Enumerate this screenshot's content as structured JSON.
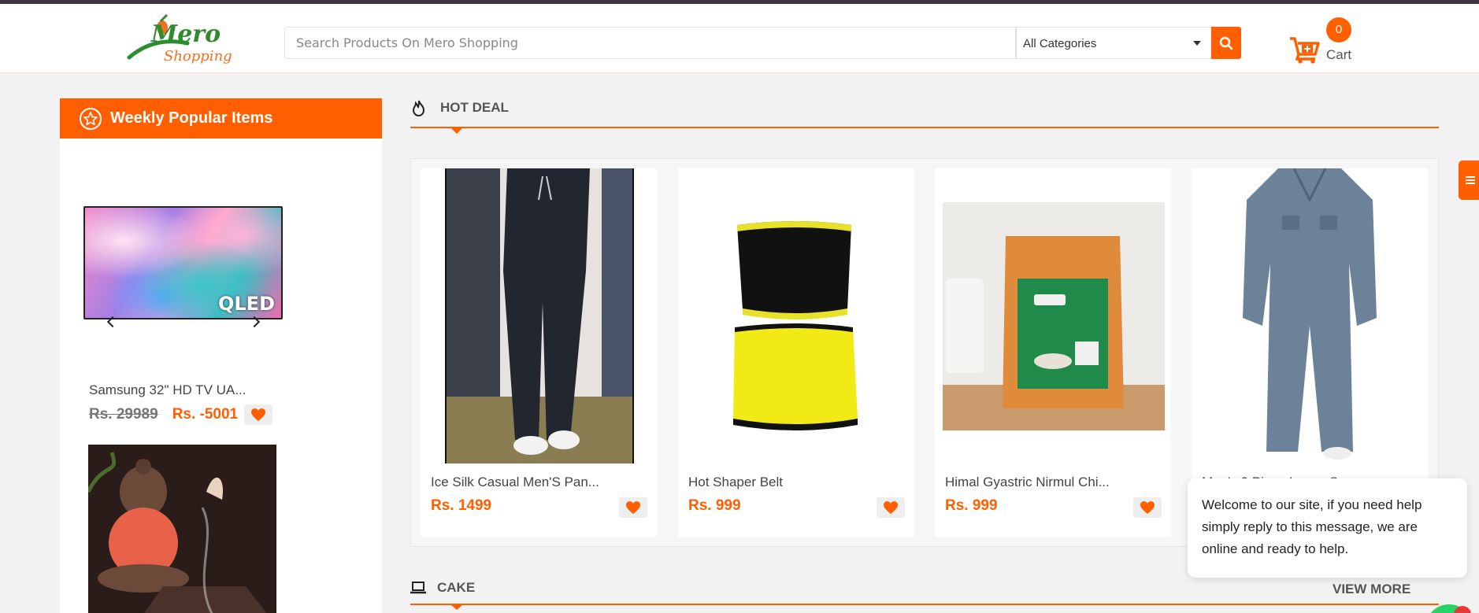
{
  "header": {
    "logo_text_1": "Mero",
    "logo_text_2": "Shopping",
    "search_placeholder": "Search Products On Mero Shopping",
    "category_selected": "All Categories",
    "cart_count": "0",
    "cart_label": "Cart"
  },
  "sidebar": {
    "title": "Weekly Popular Items",
    "items": [
      {
        "image_text": "QLED",
        "title": "Samsung 32\" HD TV UA...",
        "old_price": "Rs. 29989",
        "new_price": "Rs. -5001"
      }
    ]
  },
  "hot_deal": {
    "title": "HOT DEAL",
    "products": [
      {
        "title": "Ice Silk Casual Men'S Pan...",
        "price": "Rs. 1499"
      },
      {
        "title": "Hot Shaper Belt",
        "price": "Rs. 999"
      },
      {
        "title": "Himal Gyastric Nirmul Chi...",
        "price": "Rs. 999"
      },
      {
        "title": "Men's 2 Piece Loose S...",
        "price": ""
      }
    ]
  },
  "cake": {
    "title": "CAKE",
    "view_more": "VIEW MORE"
  },
  "chat": {
    "message": "Welcome to our site, if you need help simply reply to this message, we are online and ready to help."
  },
  "colors": {
    "accent": "#ff5f00",
    "topbar": "#3d3440",
    "background": "#f2f2f2"
  }
}
